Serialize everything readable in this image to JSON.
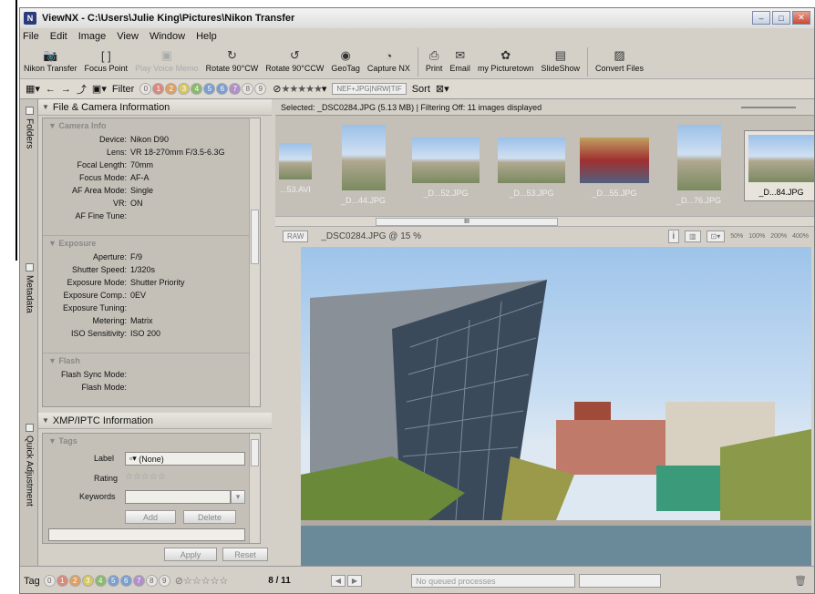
{
  "window": {
    "title": "ViewNX - C:\\Users\\Julie King\\Pictures\\Nikon Transfer",
    "app_icon": "nikon-app-icon",
    "controls": [
      "minimize",
      "maximize",
      "close"
    ]
  },
  "menu": [
    "File",
    "Edit",
    "Image",
    "View",
    "Window",
    "Help"
  ],
  "toolbar": [
    {
      "label": "Nikon Transfer",
      "icon": "camera-icon",
      "enabled": true
    },
    {
      "label": "Focus Point",
      "icon": "focus-bracket-icon",
      "enabled": true
    },
    {
      "label": "Play Voice Memo",
      "icon": "voice-memo-icon",
      "enabled": false
    },
    {
      "label": "Rotate 90°CW",
      "icon": "rotate-cw-icon",
      "enabled": true
    },
    {
      "label": "Rotate 90°CCW",
      "icon": "rotate-ccw-icon",
      "enabled": true
    },
    {
      "label": "GeoTag",
      "icon": "geotag-icon",
      "enabled": true
    },
    {
      "label": "Capture NX",
      "icon": "capture-nx-icon",
      "enabled": true
    },
    {
      "label": "Print",
      "icon": "print-icon",
      "enabled": true
    },
    {
      "label": "Email",
      "icon": "email-icon",
      "enabled": true
    },
    {
      "label": "my Picturetown",
      "icon": "picturetown-icon",
      "enabled": true
    },
    {
      "label": "SlideShow",
      "icon": "slideshow-icon",
      "enabled": true
    },
    {
      "label": "Convert Files",
      "icon": "convert-files-icon",
      "enabled": true
    }
  ],
  "filterbar": {
    "filter_label": "Filter",
    "label_numbers": [
      "0",
      "1",
      "2",
      "3",
      "4",
      "5",
      "6",
      "7",
      "8",
      "9"
    ],
    "rating_stars": "★★★★★",
    "format_filter": "NEF+JPG|NRW|TIF",
    "sort_label": "Sort"
  },
  "left_tabs": {
    "folders": "Folders",
    "metadata": "Metadata",
    "quick_adjustment": "Quick Adjustment"
  },
  "metadata": {
    "section_title": "File & Camera Information",
    "groups": [
      {
        "name": "Camera Info",
        "rows": [
          {
            "k": "Device:",
            "v": "Nikon D90"
          },
          {
            "k": "Lens:",
            "v": "VR 18-270mm F/3.5-6.3G"
          },
          {
            "k": "Focal Length:",
            "v": "70mm"
          },
          {
            "k": "Focus Mode:",
            "v": "AF-A"
          },
          {
            "k": "AF Area Mode:",
            "v": "Single"
          },
          {
            "k": "VR:",
            "v": "ON"
          },
          {
            "k": "AF Fine Tune:",
            "v": ""
          }
        ]
      },
      {
        "name": "Exposure",
        "rows": [
          {
            "k": "Aperture:",
            "v": "F/9"
          },
          {
            "k": "Shutter Speed:",
            "v": "1/320s"
          },
          {
            "k": "Exposure Mode:",
            "v": "Shutter Priority"
          },
          {
            "k": "Exposure Comp.:",
            "v": "0EV"
          },
          {
            "k": "Exposure Tuning:",
            "v": ""
          },
          {
            "k": "Metering:",
            "v": "Matrix"
          },
          {
            "k": "ISO Sensitivity:",
            "v": "ISO 200"
          }
        ]
      },
      {
        "name": "Flash",
        "rows": [
          {
            "k": "Flash Sync Mode:",
            "v": ""
          },
          {
            "k": "Flash Mode:",
            "v": ""
          }
        ]
      }
    ]
  },
  "xmp": {
    "section_title": "XMP/IPTC Information",
    "tags_label": "Tags",
    "label_field": "Label",
    "label_value": "(None)",
    "rating_field": "Rating",
    "rating_stars": "☆☆☆☆☆",
    "keywords_field": "Keywords",
    "add_button": "Add",
    "delete_button": "Delete",
    "apply_button": "Apply",
    "reset_button": "Reset"
  },
  "browser": {
    "selection_info": "Selected: _DSC0284.JPG (5.13 MB) | Filtering Off: 11 images displayed",
    "thumbnails": [
      {
        "label": "...53.AVI",
        "selected": false
      },
      {
        "label": "_D...44.JPG",
        "selected": false
      },
      {
        "label": "_D...52.JPG",
        "selected": false
      },
      {
        "label": "_D...53.JPG",
        "selected": false
      },
      {
        "label": "_D...55.JPG",
        "selected": false
      },
      {
        "label": "_D...76.JPG",
        "selected": false
      },
      {
        "label": "_D...84.JPG",
        "selected": true
      }
    ],
    "scroll_marker": "III"
  },
  "viewer": {
    "raw_label": "RAW",
    "file_label": "_DSC0284.JPG @ 15 %",
    "info_button": "i",
    "zoom_ticks": [
      "50%",
      "100%",
      "200%",
      "400%"
    ]
  },
  "status": {
    "tag_label": "Tag",
    "page_counter": "8 / 11",
    "queue_text": "No queued processes"
  }
}
